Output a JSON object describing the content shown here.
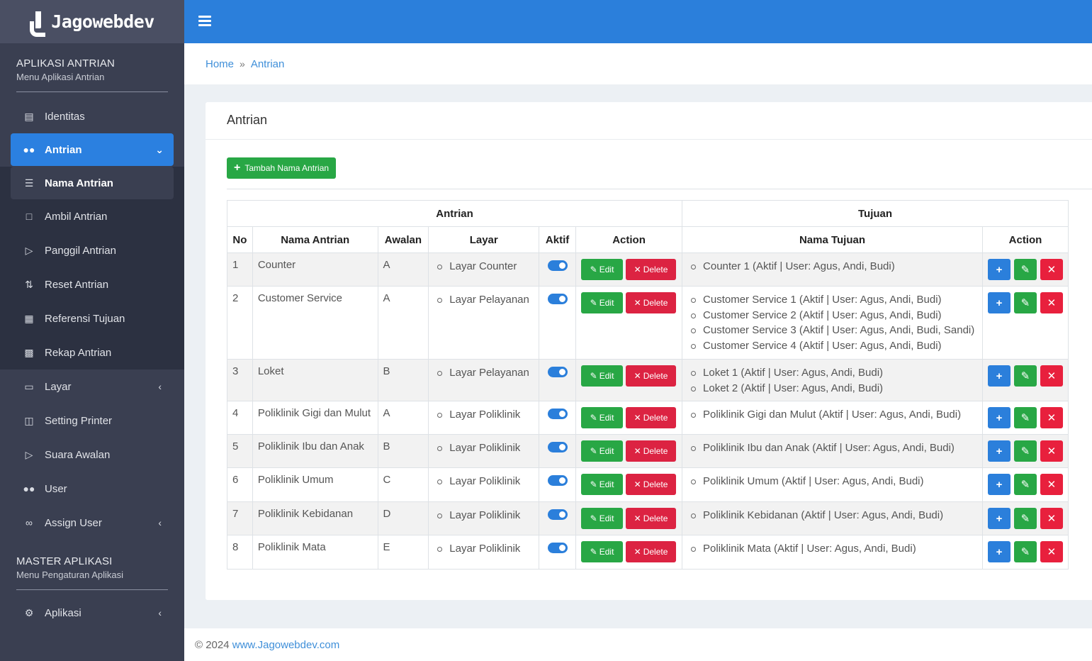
{
  "brand": {
    "name": "Jagowebdev"
  },
  "sidebar": {
    "section1": {
      "title": "APLIKASI ANTRIAN",
      "subtitle": "Menu Aplikasi Antrian"
    },
    "items": [
      {
        "label": "Identitas",
        "icon": "id-card-icon"
      },
      {
        "label": "Antrian",
        "icon": "users-icon"
      },
      {
        "label": "Nama Antrian",
        "icon": "list-icon"
      },
      {
        "label": "Ambil Antrian",
        "icon": "scroll-icon"
      },
      {
        "label": "Panggil Antrian",
        "icon": "speaker-icon"
      },
      {
        "label": "Reset Antrian",
        "icon": "reset-icon"
      },
      {
        "label": "Referensi Tujuan",
        "icon": "building-icon"
      },
      {
        "label": "Rekap Antrian",
        "icon": "chart-icon"
      },
      {
        "label": "Layar",
        "icon": "monitor-icon"
      },
      {
        "label": "Setting Printer",
        "icon": "printer-icon"
      },
      {
        "label": "Suara Awalan",
        "icon": "speaker-icon"
      },
      {
        "label": "User",
        "icon": "users-icon"
      },
      {
        "label": "Assign User",
        "icon": "link-icon"
      }
    ],
    "section2": {
      "title": "MASTER APLIKASI",
      "subtitle": "Menu Pengaturan Aplikasi"
    },
    "aplikasi": "Aplikasi"
  },
  "breadcrumb": {
    "home": "Home",
    "sep": "»",
    "current": "Antrian"
  },
  "card": {
    "title": "Antrian",
    "add_button": "Tambah Nama Antrian"
  },
  "table": {
    "group_antrian": "Antrian",
    "group_tujuan": "Tujuan",
    "headers": {
      "no": "No",
      "nama": "Nama Antrian",
      "awalan": "Awalan",
      "layar": "Layar",
      "aktif": "Aktif",
      "action": "Action",
      "nama_tujuan": "Nama Tujuan",
      "action2": "Action"
    },
    "edit_label": "Edit",
    "delete_label": "Delete",
    "rows": [
      {
        "no": "1",
        "nama": "Counter",
        "awalan": "A",
        "layar": "Layar Counter",
        "tujuan": [
          "Counter 1 (Aktif | User: Agus, Andi, Budi)"
        ]
      },
      {
        "no": "2",
        "nama": "Customer Service",
        "awalan": "A",
        "layar": "Layar Pelayanan",
        "tujuan": [
          "Customer Service 1 (Aktif | User: Agus, Andi, Budi)",
          "Customer Service 2 (Aktif | User: Agus, Andi, Budi)",
          "Customer Service 3 (Aktif | User: Agus, Andi, Budi, Sandi)",
          "Customer Service 4 (Aktif | User: Agus, Andi, Budi)"
        ]
      },
      {
        "no": "3",
        "nama": "Loket",
        "awalan": "B",
        "layar": "Layar Pelayanan",
        "tujuan": [
          "Loket 1 (Aktif | User: Agus, Andi, Budi)",
          "Loket 2 (Aktif | User: Agus, Andi, Budi)"
        ]
      },
      {
        "no": "4",
        "nama": "Poliklinik Gigi dan Mulut",
        "awalan": "A",
        "layar": "Layar Poliklinik",
        "tujuan": [
          "Poliklinik Gigi dan Mulut (Aktif | User: Agus, Andi, Budi)"
        ]
      },
      {
        "no": "5",
        "nama": "Poliklinik Ibu dan Anak",
        "awalan": "B",
        "layar": "Layar Poliklinik",
        "tujuan": [
          "Poliklinik Ibu dan Anak (Aktif | User: Agus, Andi, Budi)"
        ]
      },
      {
        "no": "6",
        "nama": "Poliklinik Umum",
        "awalan": "C",
        "layar": "Layar Poliklinik",
        "tujuan": [
          "Poliklinik Umum (Aktif | User: Agus, Andi, Budi)"
        ]
      },
      {
        "no": "7",
        "nama": "Poliklinik Kebidanan",
        "awalan": "D",
        "layar": "Layar Poliklinik",
        "tujuan": [
          "Poliklinik Kebidanan (Aktif | User: Agus, Andi, Budi)"
        ]
      },
      {
        "no": "8",
        "nama": "Poliklinik Mata",
        "awalan": "E",
        "layar": "Layar Poliklinik",
        "tujuan": [
          "Poliklinik Mata (Aktif | User: Agus, Andi, Budi)"
        ]
      }
    ]
  },
  "footer": {
    "copy": "© 2024",
    "link": "www.Jagowebdev.com"
  },
  "colors": {
    "primary": "#2b7fdb",
    "sidebar": "#3a3f51",
    "success": "#28a745",
    "danger": "#dc2342"
  }
}
